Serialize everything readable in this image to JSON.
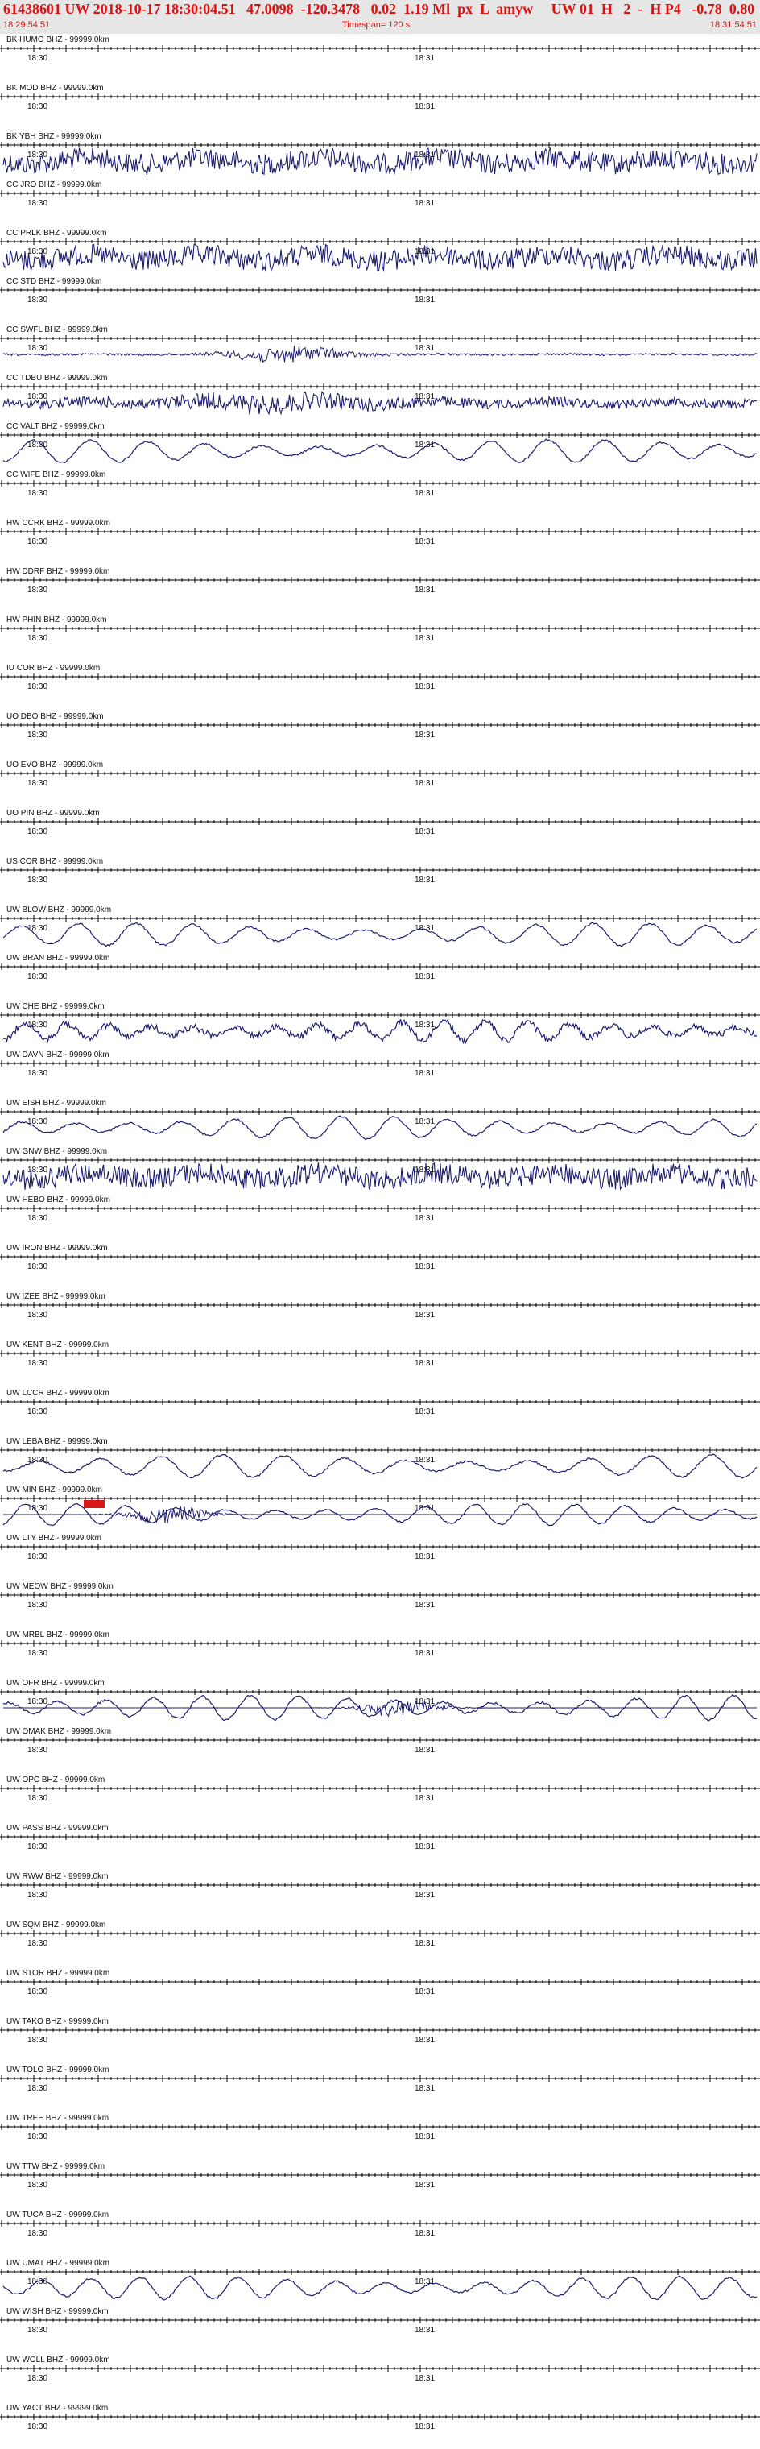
{
  "header": {
    "event_line": "61438601 UW 2018-10-17 18:30:04.51   47.0098  -120.3478   0.02  1.19 Ml  px  L  amyw     UW 01  H   2  -  H P4   -0.78  0.80",
    "start_time": "18:29:54.51",
    "timespan": "Timespan= 120 s",
    "end_time": "18:31:54.51"
  },
  "axis": {
    "tick_left": "18:30",
    "tick_right": "18:31",
    "time_window_seconds": 120
  },
  "colors": {
    "trace": "#1c1c6e",
    "header_text": "#e01010",
    "header_bg": "#e6e6e6",
    "pick_marker": "#d81818"
  },
  "stations": [
    {
      "label": "BK HUMO BHZ - 99999.0km",
      "activity": "flat"
    },
    {
      "label": "BK MOD BHZ - 99999.0km",
      "activity": "flat"
    },
    {
      "label": "BK YBH BHZ - 99999.0km",
      "activity": "noise-heavy"
    },
    {
      "label": "CC JRO BHZ - 99999.0km",
      "activity": "flat"
    },
    {
      "label": "CC PRLK BHZ - 99999.0km",
      "activity": "noise-heavy"
    },
    {
      "label": "CC STD BHZ - 99999.0km",
      "activity": "flat"
    },
    {
      "label": "CC SWFL BHZ - 99999.0km",
      "activity": "burst"
    },
    {
      "label": "CC TDBU BHZ - 99999.0km",
      "activity": "noise-medium"
    },
    {
      "label": "CC VALT BHZ - 99999.0km",
      "activity": "wave"
    },
    {
      "label": "CC WIFE BHZ - 99999.0km",
      "activity": "flat"
    },
    {
      "label": "HW CCRK BHZ - 99999.0km",
      "activity": "flat"
    },
    {
      "label": "HW DDRF BHZ - 99999.0km",
      "activity": "flat"
    },
    {
      "label": "HW PHIN BHZ - 99999.0km",
      "activity": "flat"
    },
    {
      "label": "IU COR BHZ - 99999.0km",
      "activity": "flat"
    },
    {
      "label": "UO DBO BHZ - 99999.0km",
      "activity": "flat"
    },
    {
      "label": "UO EVO BHZ - 99999.0km",
      "activity": "flat"
    },
    {
      "label": "UO PIN BHZ - 99999.0km",
      "activity": "flat"
    },
    {
      "label": "US COR BHZ - 99999.0km",
      "activity": "flat"
    },
    {
      "label": "UW BLOW BHZ - 99999.0km",
      "activity": "wave"
    },
    {
      "label": "UW BRAN BHZ - 99999.0km",
      "activity": "flat"
    },
    {
      "label": "UW CHE BHZ - 99999.0km",
      "activity": "wave-noisy"
    },
    {
      "label": "UW DAVN BHZ - 99999.0km",
      "activity": "flat"
    },
    {
      "label": "UW EISH BHZ - 99999.0km",
      "activity": "wave"
    },
    {
      "label": "UW GNW BHZ - 99999.0km",
      "activity": "noise-heavy"
    },
    {
      "label": "UW HEBO BHZ - 99999.0km",
      "activity": "flat"
    },
    {
      "label": "UW IRON BHZ - 99999.0km",
      "activity": "flat"
    },
    {
      "label": "UW IZEE BHZ - 99999.0km",
      "activity": "flat"
    },
    {
      "label": "UW KENT BHZ - 99999.0km",
      "activity": "flat"
    },
    {
      "label": "UW LCCR BHZ - 99999.0km",
      "activity": "flat"
    },
    {
      "label": "UW LEBA BHZ - 99999.0km",
      "activity": "wave"
    },
    {
      "label": "UW MIN BHZ - 99999.0km",
      "activity": "event"
    },
    {
      "label": "UW LTY BHZ - 99999.0km",
      "activity": "flat"
    },
    {
      "label": "UW MEOW BHZ - 99999.0km",
      "activity": "flat"
    },
    {
      "label": "UW MRBL BHZ - 99999.0km",
      "activity": "flat"
    },
    {
      "label": "UW OFR BHZ - 99999.0km",
      "activity": "wave-event"
    },
    {
      "label": "UW OMAK BHZ - 99999.0km",
      "activity": "flat"
    },
    {
      "label": "UW OPC BHZ - 99999.0km",
      "activity": "flat"
    },
    {
      "label": "UW PASS BHZ - 99999.0km",
      "activity": "flat"
    },
    {
      "label": "UW RWW BHZ - 99999.0km",
      "activity": "flat"
    },
    {
      "label": "UW SQM BHZ - 99999.0km",
      "activity": "flat"
    },
    {
      "label": "UW STOR BHZ - 99999.0km",
      "activity": "flat"
    },
    {
      "label": "UW TAKO BHZ - 99999.0km",
      "activity": "flat"
    },
    {
      "label": "UW TOLO BHZ - 99999.0km",
      "activity": "flat"
    },
    {
      "label": "UW TREE BHZ - 99999.0km",
      "activity": "flat"
    },
    {
      "label": "UW TTW BHZ - 99999.0km",
      "activity": "flat"
    },
    {
      "label": "UW TUCA BHZ - 99999.0km",
      "activity": "flat"
    },
    {
      "label": "UW UMAT BHZ - 99999.0km",
      "activity": "wave"
    },
    {
      "label": "UW WISH BHZ - 99999.0km",
      "activity": "flat"
    },
    {
      "label": "UW WOLL BHZ - 99999.0km",
      "activity": "flat"
    },
    {
      "label": "UW YACT BHZ - 99999.0km",
      "activity": "flat"
    }
  ]
}
